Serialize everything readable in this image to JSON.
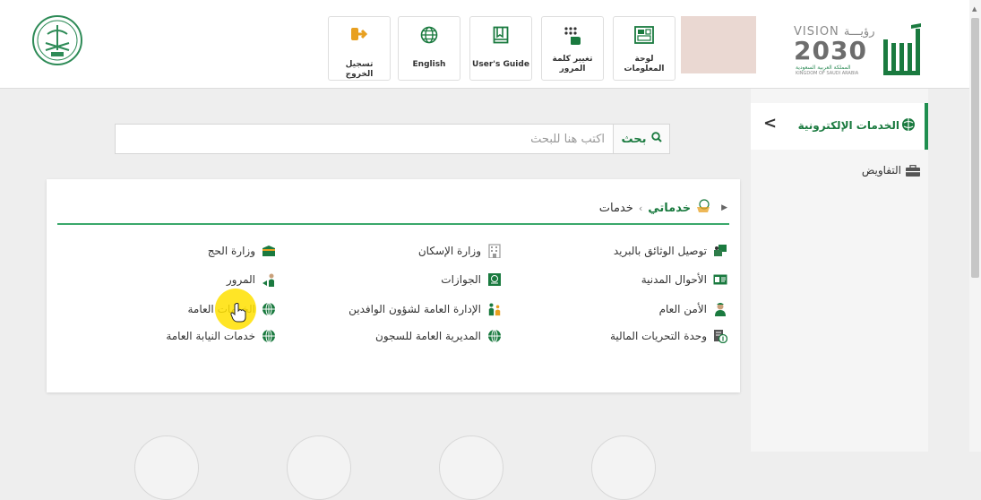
{
  "header": {
    "toolbar": [
      {
        "id": "logout",
        "label": "تسجيل الخروج",
        "icon": "logout-icon"
      },
      {
        "id": "english",
        "label": "English",
        "icon": "globe-icon"
      },
      {
        "id": "guide",
        "label": "User's Guide",
        "icon": "book-icon"
      },
      {
        "id": "password",
        "label_line1": "تغيير كلمة",
        "label_line2": "المرور",
        "icon": "keypad-icon"
      },
      {
        "id": "dashboard",
        "label_line1": "لوحة",
        "label_line2": "المعلومات",
        "icon": "dashboard-icon"
      }
    ],
    "vision": {
      "en": "VISION",
      "ar": "رؤيـــة",
      "year": "2030",
      "sub_ar": "المملكة العربية السعودية",
      "sub_en": "KINGDOM OF SAUDI ARABIA"
    }
  },
  "sidebar": {
    "header_label": "الخدمات الإلكترونية",
    "items": [
      {
        "label": "التفاويض"
      }
    ]
  },
  "search": {
    "button_label": "بحث",
    "placeholder": "اكتب هنا للبحث"
  },
  "breadcrumb": {
    "current": "خدماتي",
    "child": "خدمات"
  },
  "services": {
    "col1": [
      {
        "label": "توصيل الوثائق بالبريد",
        "icon": "mail-delivery-icon"
      },
      {
        "label": "الأحوال المدنية",
        "icon": "id-card-icon"
      },
      {
        "label": "الأمن العام",
        "icon": "officer-icon"
      },
      {
        "label": "وحدة التحريات المالية",
        "icon": "finance-icon"
      }
    ],
    "col2": [
      {
        "label": "وزارة الإسكان",
        "icon": "building-icon"
      },
      {
        "label": "الجوازات",
        "icon": "passport-icon"
      },
      {
        "label": "الإدارة العامة لشؤون الوافدين",
        "icon": "people-icon"
      },
      {
        "label": "المديرية العامة للسجون",
        "icon": "globe-icon"
      }
    ],
    "col3": [
      {
        "label": "وزارة الحج",
        "icon": "kaaba-icon"
      },
      {
        "label": "المرور",
        "icon": "traffic-icon"
      },
      {
        "label": "الخدمات العامة",
        "icon": "globe-icon"
      },
      {
        "label": "خدمات النيابة العامة",
        "icon": "globe-icon"
      }
    ]
  },
  "colors": {
    "brand_green": "#1a7a3f",
    "accent": "#e8a020"
  }
}
